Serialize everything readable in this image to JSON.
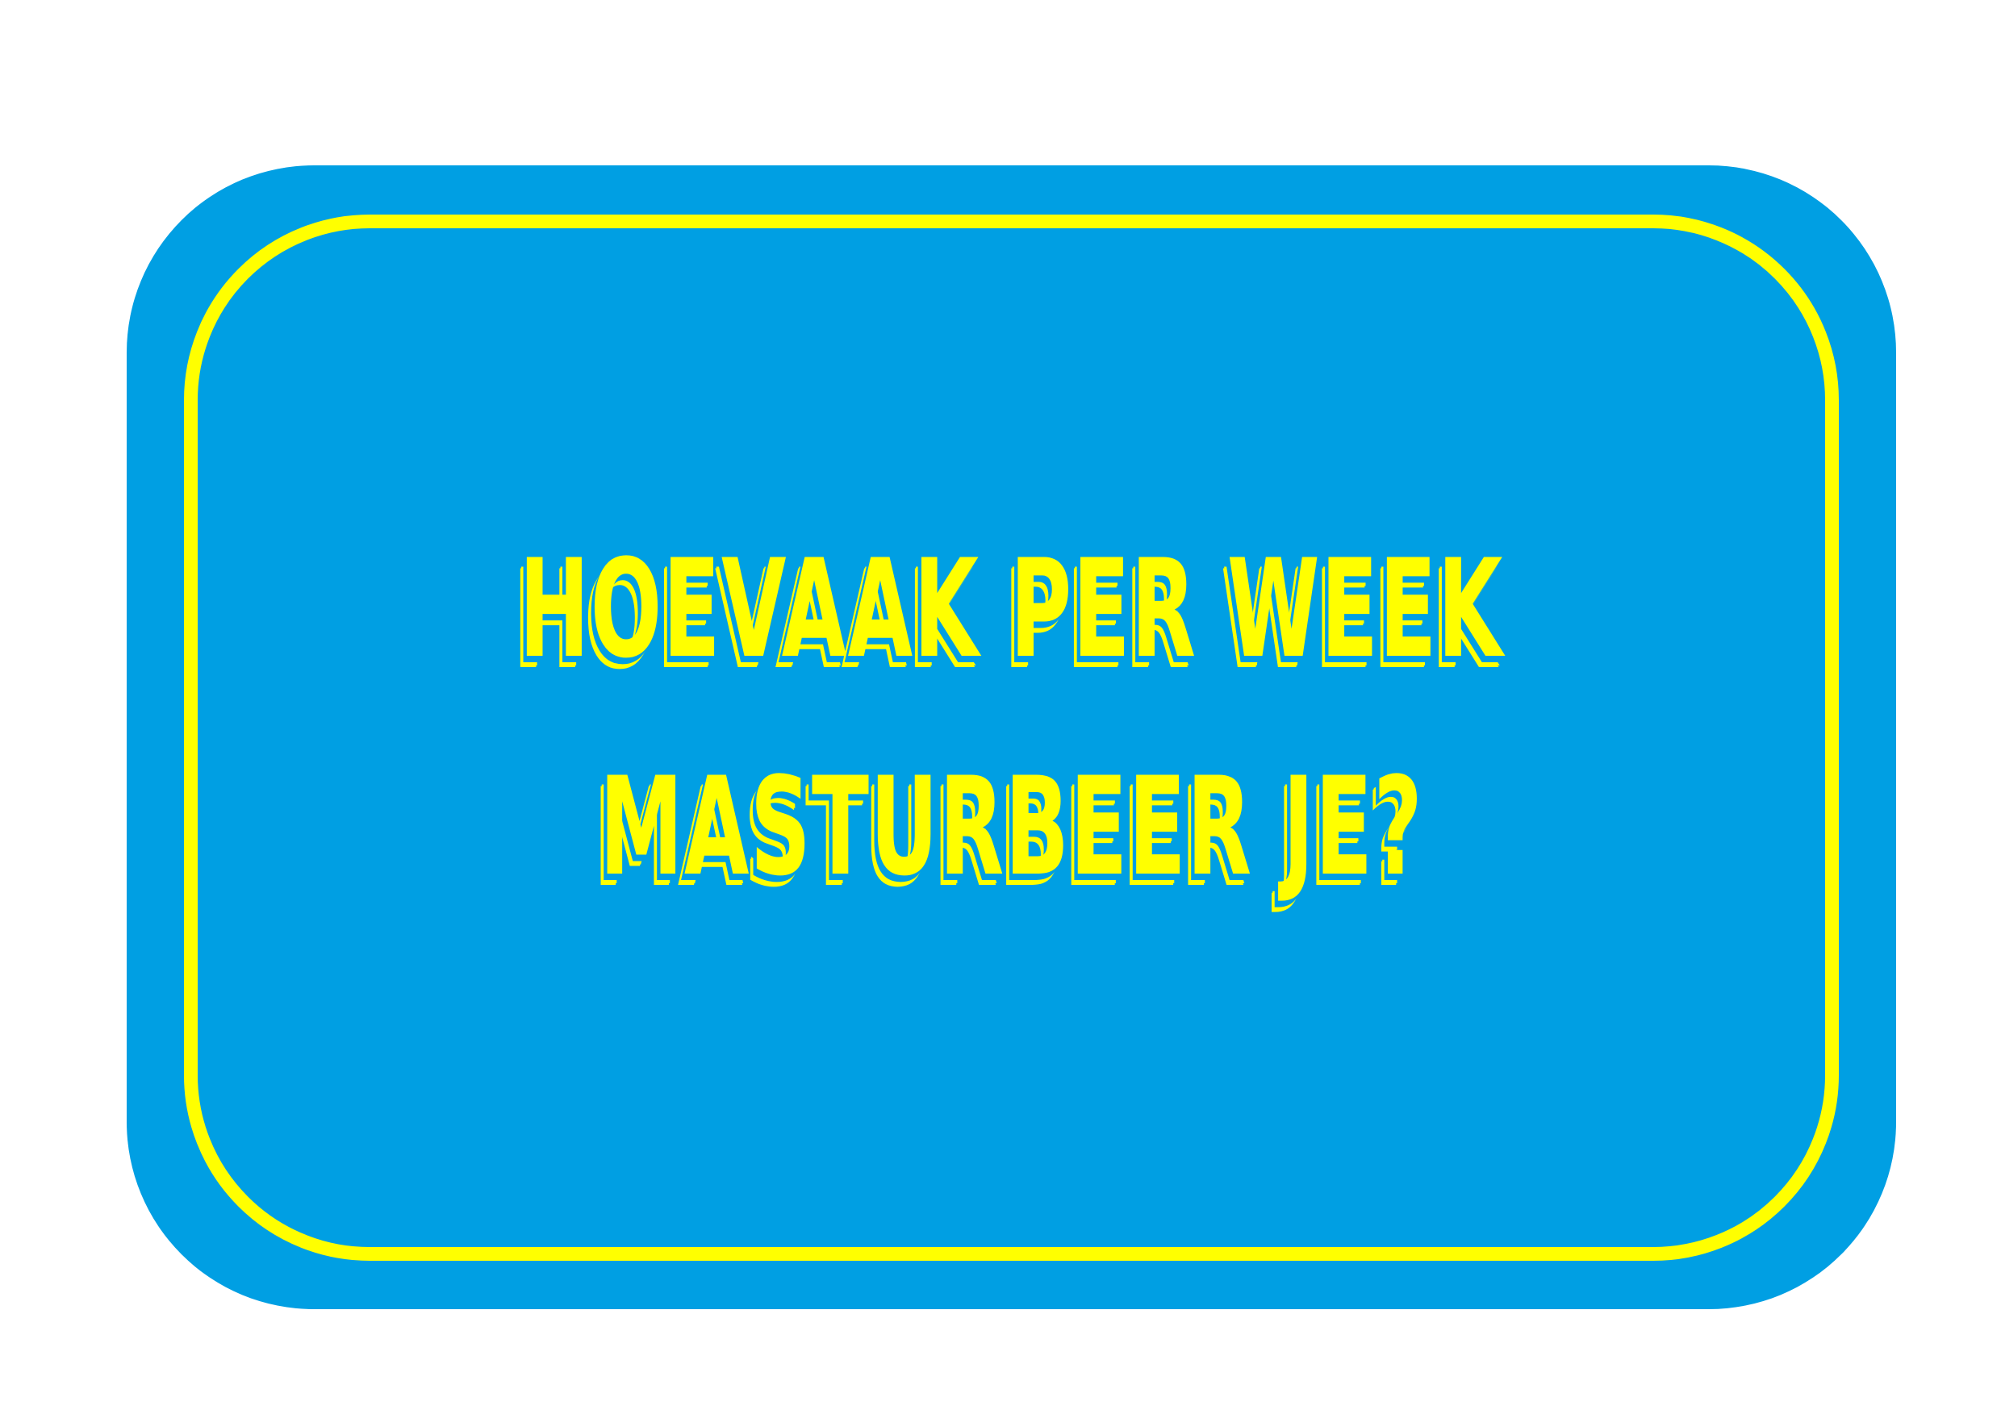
{
  "card": {
    "question_line_1": "HOEVAAK PER WEEK",
    "question_line_2": "MASTURBEER JE?"
  },
  "colors": {
    "background": "#ffffff",
    "card_fill": "#009fe3",
    "accent": "#ffff00"
  }
}
